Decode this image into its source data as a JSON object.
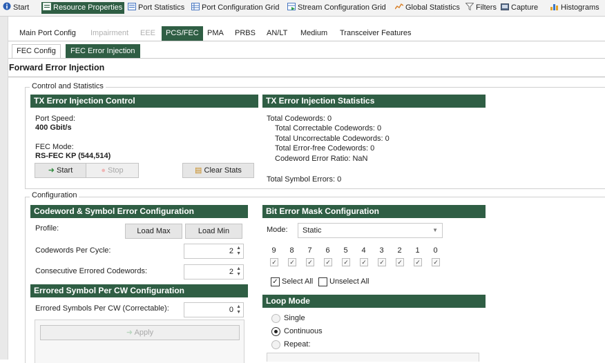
{
  "top_tabs": [
    {
      "label": "Start",
      "icon": "info-icon"
    },
    {
      "label": "Resource Properties",
      "icon": "properties-icon",
      "active": true
    },
    {
      "label": "Port Statistics",
      "icon": "port-stats-icon"
    },
    {
      "label": "Port Configuration Grid",
      "icon": "grid-icon"
    },
    {
      "label": "Stream Configuration Grid",
      "icon": "stream-grid-icon"
    },
    {
      "label": "Global Statistics",
      "icon": "global-stats-icon"
    },
    {
      "label": "Filters",
      "icon": "filter-icon"
    },
    {
      "label": "Capture",
      "icon": "capture-icon"
    },
    {
      "label": "Histograms",
      "icon": "histogram-icon"
    }
  ],
  "sub_tabs": [
    {
      "label": "Main Port Config"
    },
    {
      "label": "Impairment",
      "disabled": true
    },
    {
      "label": "EEE",
      "disabled": true
    },
    {
      "label": "PCS/FEC",
      "active": true
    },
    {
      "label": "PMA"
    },
    {
      "label": "PRBS"
    },
    {
      "label": "AN/LT"
    },
    {
      "label": "Medium"
    },
    {
      "label": "Transceiver Features"
    }
  ],
  "fec_tabs": [
    {
      "label": "FEC Config"
    },
    {
      "label": "FEC Error Injection",
      "active": true
    }
  ],
  "page_title": "Forward Error Injection",
  "control_group": {
    "label": "Control and Statistics",
    "tx_control": {
      "header": "TX Error Injection Control",
      "port_speed_label": "Port Speed:",
      "port_speed_value": "400 Gbit/s",
      "fec_mode_label": "FEC Mode:",
      "fec_mode_value": "RS-FEC KP (544,514)",
      "start_label": "Start",
      "stop_label": "Stop",
      "clear_label": "Clear Stats"
    },
    "tx_stats": {
      "header": "TX Error Injection Statistics",
      "total_codewords": "Total Codewords: 0",
      "correctable": "Total Correctable Codewords: 0",
      "uncorrectable": "Total Uncorrectable Codewords: 0",
      "error_free": "Total Error-free Codewords: 0",
      "error_ratio": "Codeword Error Ratio: NaN",
      "symbol_errors": "Total Symbol Errors: 0"
    }
  },
  "config_group": {
    "label": "Configuration",
    "codeword": {
      "header": "Codeword & Symbol Error Configuration",
      "profile_label": "Profile:",
      "load_max_label": "Load Max",
      "load_min_label": "Load Min",
      "per_cycle_label": "Codewords Per Cycle:",
      "per_cycle_value": "2",
      "consecutive_label": "Consecutive Errored Codewords:",
      "consecutive_value": "2"
    },
    "errored_symbol": {
      "header": "Errored Symbol Per CW Configuration",
      "per_cw_label": "Errored Symbols Per CW (Correctable):",
      "per_cw_value": "0",
      "apply_label": "Apply"
    },
    "bit_mask": {
      "header": "Bit Error Mask Configuration",
      "mode_label": "Mode:",
      "mode_value": "Static",
      "bits": [
        "9",
        "8",
        "7",
        "6",
        "5",
        "4",
        "3",
        "2",
        "1",
        "0"
      ],
      "check_mark": "✓",
      "select_all_label": "Select All",
      "unselect_all_label": "Unselect All"
    },
    "loop_mode": {
      "header": "Loop Mode",
      "options": [
        "Single",
        "Continuous",
        "Repeat:"
      ],
      "selected": "Continuous"
    }
  },
  "colors": {
    "header_green": "#2f5e44",
    "active_tab": "#2f5e44"
  }
}
